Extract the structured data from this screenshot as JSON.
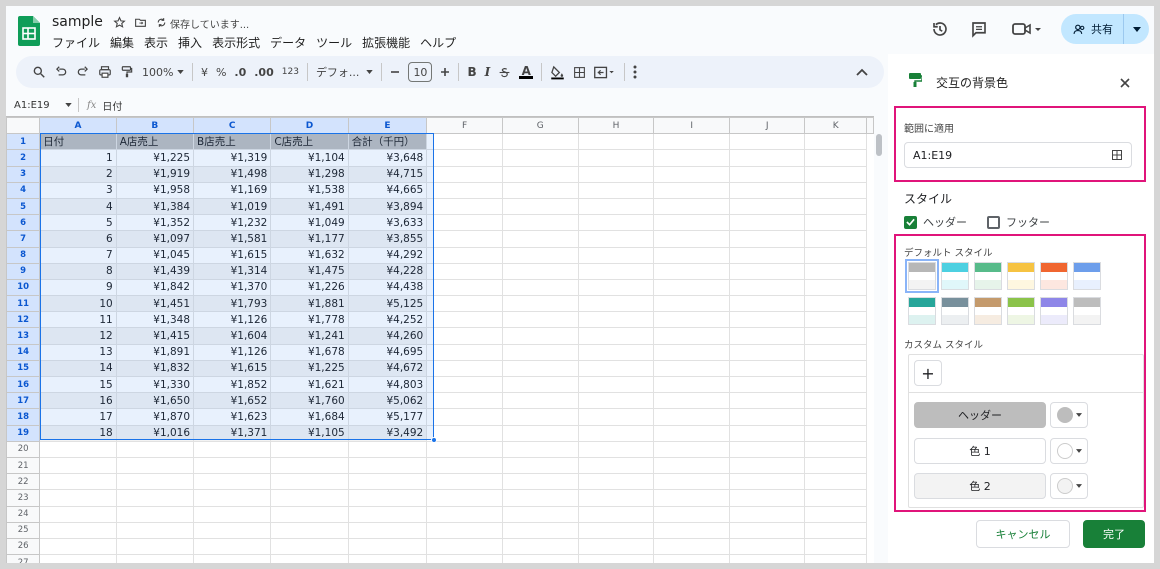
{
  "app": {
    "title": "sample",
    "saving_text": "保存しています..."
  },
  "menu": {
    "items": [
      "ファイル",
      "編集",
      "表示",
      "挿入",
      "表示形式",
      "データ",
      "ツール",
      "拡張機能",
      "ヘルプ"
    ]
  },
  "share": {
    "label": "共有"
  },
  "toolbar": {
    "zoom": "100%",
    "currency": "¥",
    "percent": "%",
    "dec_dec": ".0",
    "dec_inc": ".00",
    "num_format": "123",
    "font": "デフォ...",
    "font_size": "10",
    "bold": "B",
    "italic": "I",
    "underline_a": "A"
  },
  "formula_bar": {
    "name_box": "A1:E19",
    "fx": "fx",
    "content": "日付"
  },
  "grid": {
    "columns": [
      "A",
      "B",
      "C",
      "D",
      "E",
      "F",
      "G",
      "H",
      "I",
      "J",
      "K"
    ],
    "header": [
      "日付",
      "A店売上",
      "B店売上",
      "C店売上",
      "合計（千円）"
    ],
    "rows": [
      [
        "1",
        "¥1,225",
        "¥1,319",
        "¥1,104",
        "¥3,648"
      ],
      [
        "2",
        "¥1,919",
        "¥1,498",
        "¥1,298",
        "¥4,715"
      ],
      [
        "3",
        "¥1,958",
        "¥1,169",
        "¥1,538",
        "¥4,665"
      ],
      [
        "4",
        "¥1,384",
        "¥1,019",
        "¥1,491",
        "¥3,894"
      ],
      [
        "5",
        "¥1,352",
        "¥1,232",
        "¥1,049",
        "¥3,633"
      ],
      [
        "6",
        "¥1,097",
        "¥1,581",
        "¥1,177",
        "¥3,855"
      ],
      [
        "7",
        "¥1,045",
        "¥1,615",
        "¥1,632",
        "¥4,292"
      ],
      [
        "8",
        "¥1,439",
        "¥1,314",
        "¥1,475",
        "¥4,228"
      ],
      [
        "9",
        "¥1,842",
        "¥1,370",
        "¥1,226",
        "¥4,438"
      ],
      [
        "10",
        "¥1,451",
        "¥1,793",
        "¥1,881",
        "¥5,125"
      ],
      [
        "11",
        "¥1,348",
        "¥1,126",
        "¥1,778",
        "¥4,252"
      ],
      [
        "12",
        "¥1,415",
        "¥1,604",
        "¥1,241",
        "¥4,260"
      ],
      [
        "13",
        "¥1,891",
        "¥1,126",
        "¥1,678",
        "¥4,695"
      ],
      [
        "14",
        "¥1,832",
        "¥1,615",
        "¥1,225",
        "¥4,672"
      ],
      [
        "15",
        "¥1,330",
        "¥1,852",
        "¥1,621",
        "¥4,803"
      ],
      [
        "16",
        "¥1,650",
        "¥1,652",
        "¥1,760",
        "¥5,062"
      ],
      [
        "17",
        "¥1,870",
        "¥1,623",
        "¥1,684",
        "¥5,177"
      ],
      [
        "18",
        "¥1,016",
        "¥1,371",
        "¥1,105",
        "¥3,492"
      ]
    ],
    "row_numbers": [
      "1",
      "2",
      "3",
      "4",
      "5",
      "6",
      "7",
      "8",
      "9",
      "10",
      "11",
      "12",
      "13",
      "14",
      "15",
      "16",
      "17",
      "18",
      "19",
      "20",
      "21",
      "22",
      "23",
      "24",
      "25",
      "26",
      "27"
    ]
  },
  "panel": {
    "title": "交互の背景色",
    "range_label": "範囲に適用",
    "range_value": "A1:E19",
    "style_label": "スタイル",
    "header_check": "ヘッダー",
    "footer_check": "フッター",
    "default_styles_label": "デフォルト スタイル",
    "custom_styles_label": "カスタム スタイル",
    "add_label": "+",
    "header_btn": "ヘッダー",
    "color1_btn": "色 1",
    "color2_btn": "色 2",
    "cancel": "キャンセル",
    "done": "完了"
  },
  "colors": {
    "accent": "#188038",
    "highlight": "#e0147a",
    "selection": "#1a73e8",
    "header_fill": "#bdbdbd",
    "alt_fill": "#f3f3f3",
    "swatches": [
      "#b7b7b7",
      "#4dd0e1",
      "#57bb8a",
      "#f6c342",
      "#f06630",
      "#6d9eeb",
      "#26a69a",
      "#78909c",
      "#c49a6c",
      "#8bc34a",
      "#8e86e8",
      "#bdbdbd"
    ],
    "swatch_light": [
      "#f3f3f3",
      "#e0f7fa",
      "#e6f4ea",
      "#fef7e0",
      "#fde7e0",
      "#e8f0fe",
      "#ddf2f0",
      "#eceff1",
      "#f6ece1",
      "#eef6e4",
      "#ecebfb",
      "#f3f3f3"
    ]
  },
  "icons": [
    "sheets-logo-icon",
    "star-icon",
    "move-folder-icon",
    "sync-status-icon",
    "history-icon",
    "comment-icon",
    "meet-icon",
    "share-user-icon",
    "chevron-down-icon",
    "search-icon",
    "undo-icon",
    "redo-icon",
    "print-icon",
    "paint-format-icon",
    "text-color-icon",
    "fill-color-icon",
    "borders-icon",
    "merge-icon",
    "more-icon",
    "collapse-icon",
    "alternating-colors-icon",
    "close-icon",
    "grid-select-icon"
  ]
}
